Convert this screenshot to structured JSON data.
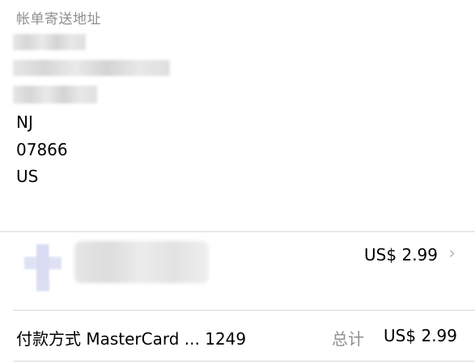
{
  "billing": {
    "section_label": "帐单寄送地址",
    "state": "NJ",
    "zip": "07866",
    "country": "US"
  },
  "item": {
    "price": "US$ 2.99",
    "chevron_icon": "chevron-right-icon"
  },
  "footer": {
    "payment_method": "付款方式 MasterCard ... 1249",
    "total_label": "总计",
    "total_value": "US$ 2.99"
  },
  "colors": {
    "secondary_text": "#8e8e93",
    "divider": "#d9d9de",
    "chevron": "#b8b8bd"
  }
}
